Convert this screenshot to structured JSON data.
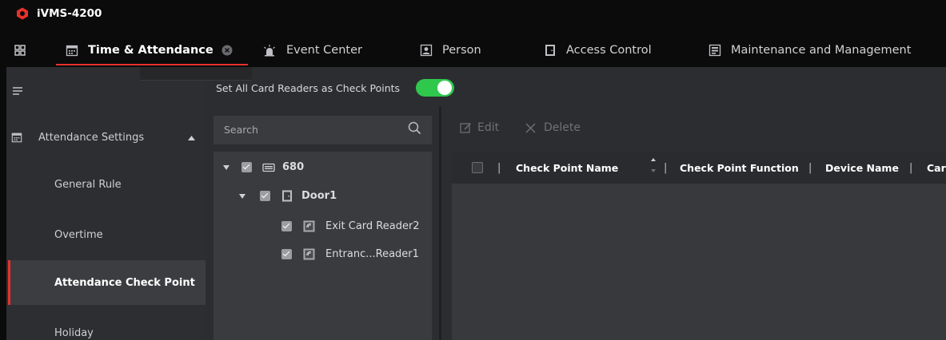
{
  "app": {
    "title": "iVMS-4200"
  },
  "tabs": [
    {
      "label": "Time & Attendance",
      "icon": "calendar-icon",
      "active": true
    },
    {
      "label": "Event Center",
      "icon": "alarm-light-icon"
    },
    {
      "label": "Person",
      "icon": "person-card-icon"
    },
    {
      "label": "Access Control",
      "icon": "door-icon"
    },
    {
      "label": "Maintenance and Management",
      "icon": "server-icon"
    }
  ],
  "sidebar": {
    "group": {
      "label": "Attendance Settings",
      "icon": "calendar-icon",
      "expanded": true
    },
    "items": [
      {
        "label": "General Rule"
      },
      {
        "label": "Overtime"
      },
      {
        "label": "Attendance Check Point",
        "active": true
      },
      {
        "label": "Holiday"
      }
    ]
  },
  "main": {
    "set_all_label": "Set All Card Readers as Check Points",
    "set_all_enabled": true
  },
  "tree": {
    "search_placeholder": "Search",
    "nodes": [
      {
        "label": "680",
        "icon": "device-icon",
        "checked": true,
        "expanded": true
      },
      {
        "label": "Door1",
        "icon": "door-icon",
        "checked": true,
        "expanded": true
      },
      {
        "label": "Exit Card Reader2",
        "icon": "card-reader-icon",
        "checked": true
      },
      {
        "label": "Entranc...Reader1",
        "icon": "card-reader-icon",
        "checked": true
      }
    ]
  },
  "toolbar": {
    "edit_label": "Edit",
    "delete_label": "Delete"
  },
  "table": {
    "columns": [
      "Check Point Name",
      "Check Point Function",
      "Device Name",
      "Car"
    ],
    "separator": "|",
    "rows": []
  },
  "colors": {
    "accent": "#e8312a",
    "toggle_on": "#2fc84d",
    "background": "#2c2d30",
    "titlebar": "#0b0b0c"
  }
}
